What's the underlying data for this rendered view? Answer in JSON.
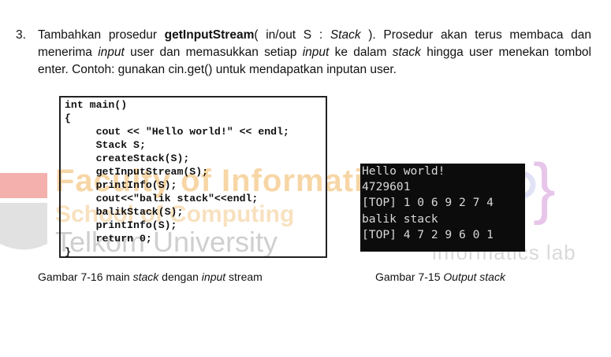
{
  "instruction": {
    "number": "3.",
    "text_before": "Tambahkan prosedur ",
    "procedure_name": "getInputStream",
    "text_mid": "( in/out S : ",
    "param_type": "Stack",
    "text_a": " ). Prosedur akan terus membaca dan menerima ",
    "word_input1": "input",
    "text_b": " user dan memasukkan setiap ",
    "word_input2": "input",
    "text_c": " ke dalam ",
    "word_stack": "stack",
    "text_d": " hingga user menekan tombol enter. Contoh: gunakan cin.get() untuk mendapatkan inputan user."
  },
  "code_listing": [
    "int main()",
    "{",
    "     cout << \"Hello world!\" << endl;",
    "     Stack S;",
    "     createStack(S);",
    "     getInputStream(S);",
    "     printInfo(S);",
    "     cout<<\"balik stack\"<<endl;",
    "     balikStack(S);",
    "     printInfo(S);",
    "     return 0;",
    "}"
  ],
  "console_output": [
    "Hello world!",
    "4729601",
    "[TOP] 1 0 6 9 2 7 4",
    "balik stack",
    "[TOP] 4 7 2 9 6 0 1"
  ],
  "captions": {
    "left": {
      "prefix": "Gambar 7-16 main ",
      "italic1": "stack",
      "middle": " dengan ",
      "italic2": "input",
      "suffix": " stream"
    },
    "right": {
      "prefix": "Gambar 7-15 ",
      "italic": "Output stack"
    }
  },
  "watermark": {
    "line1": "Faculty of Informatics",
    "line2": "School of Computing",
    "line3": "Telkom University",
    "right_text": "informatics lab"
  },
  "colors": {
    "console_bg": "#0c0c0c",
    "console_text": "#d8d8d8",
    "watermark_red": "#e8473f",
    "watermark_orange": "#f7d6a6"
  }
}
